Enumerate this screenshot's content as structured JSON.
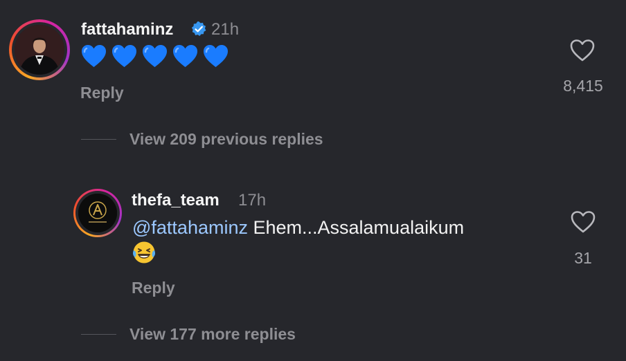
{
  "comments": [
    {
      "username": "fattahaminz",
      "verified": true,
      "time": "21h",
      "text": "💙💙💙💙💙",
      "reply_label": "Reply",
      "like_count": "8,415",
      "icons": {
        "like": "heart-outline-icon",
        "verified": "verified-badge-icon"
      }
    }
  ],
  "thread": {
    "view_previous": "View 209 previous replies",
    "view_more": "View 177 more replies"
  },
  "reply": {
    "username": "thefa_team",
    "time": "17h",
    "mention": "@fattahaminz",
    "text": " Ehem...Assalamualaikum",
    "emoji": "😂",
    "reply_label": "Reply",
    "like_count": "31",
    "avatar_text": "thefa_team"
  },
  "colors": {
    "background": "#26272c",
    "mention": "#9cc8ff",
    "verified": "#3897f0",
    "heart_emoji": "#1a7cff",
    "muted": "#8e8e93"
  }
}
